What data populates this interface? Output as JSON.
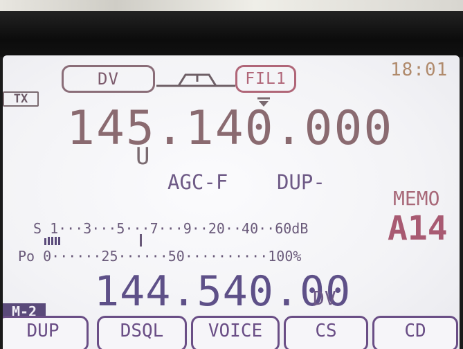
{
  "display": {
    "mode": "DV",
    "filter": "FIL1",
    "tx_indicator": "TX",
    "clock": "18:01",
    "main_frequency": "145.140.000",
    "offset_direction": "U",
    "agc": "AGC-F",
    "duplex": "DUP-",
    "memo_label": "MEMO",
    "memo_channel": "A14",
    "s_meter_scale": "S 1···3···5···7···9··20··40··60dB",
    "po_meter_scale": "Po 0······25······50··········100%",
    "sub_frequency": "144.540.00",
    "sub_mode": "DV",
    "memory_badge": "M-2"
  },
  "softkeys": [
    {
      "label": "DUP"
    },
    {
      "label": "DSQL"
    },
    {
      "label": "VOICE"
    },
    {
      "label": "CS"
    },
    {
      "label": "CD"
    }
  ],
  "colors": {
    "bezel": "#0c0c0c",
    "screen_bg": "#f3f3f6",
    "main_freq": "#8a6a70",
    "accent_orange": "#b3785a",
    "purple": "#6a4e86",
    "memo_red": "#a85a72"
  }
}
